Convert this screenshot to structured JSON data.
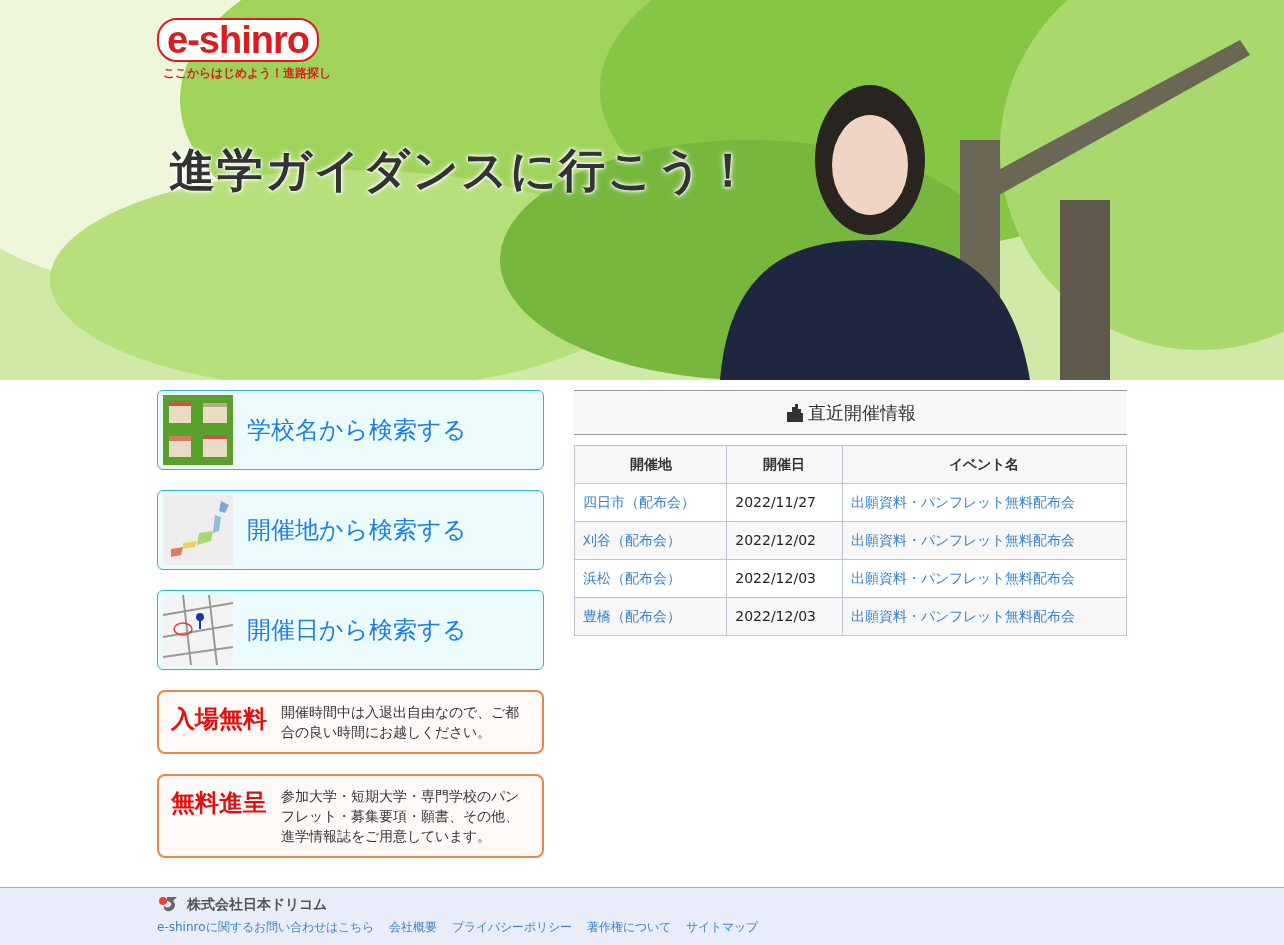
{
  "header": {
    "logo": "e-shinro",
    "tagline": "ここからはじめよう！進路探し",
    "headline": "進学ガイダンスに行こう！"
  },
  "search_buttons": [
    {
      "kind": "school",
      "label": "学校名から検索する"
    },
    {
      "kind": "map",
      "label": "開催地から検索する"
    },
    {
      "kind": "calendar",
      "label": "開催日から検索する"
    }
  ],
  "notices": [
    {
      "title": "入場無料",
      "text": "開催時間中は入退出自由なので、ご都合の良い時間にお越しください。"
    },
    {
      "title": "無料進呈",
      "text": "参加大学・短期大学・専門学校のパンフレット・募集要項・願書、その他、進学情報誌をご用意しています。"
    }
  ],
  "events": {
    "title": "直近開催情報",
    "columns": [
      "開催地",
      "開催日",
      "イベント名"
    ],
    "rows": [
      [
        "四日市（配布会）",
        "2022/11/27",
        "出願資料・パンフレット無料配布会"
      ],
      [
        "刈谷（配布会）",
        "2022/12/02",
        "出願資料・パンフレット無料配布会"
      ],
      [
        "浜松（配布会）",
        "2022/12/03",
        "出願資料・パンフレット無料配布会"
      ],
      [
        "豊橋（配布会）",
        "2022/12/03",
        "出願資料・パンフレット無料配布会"
      ]
    ]
  },
  "footer": {
    "company": "株式会社日本ドリコム",
    "links": [
      "e-shinroに関するお問い合わせはこちら",
      "会社概要",
      "プライバシーポリシー",
      "著作権について",
      "サイトマップ"
    ]
  }
}
